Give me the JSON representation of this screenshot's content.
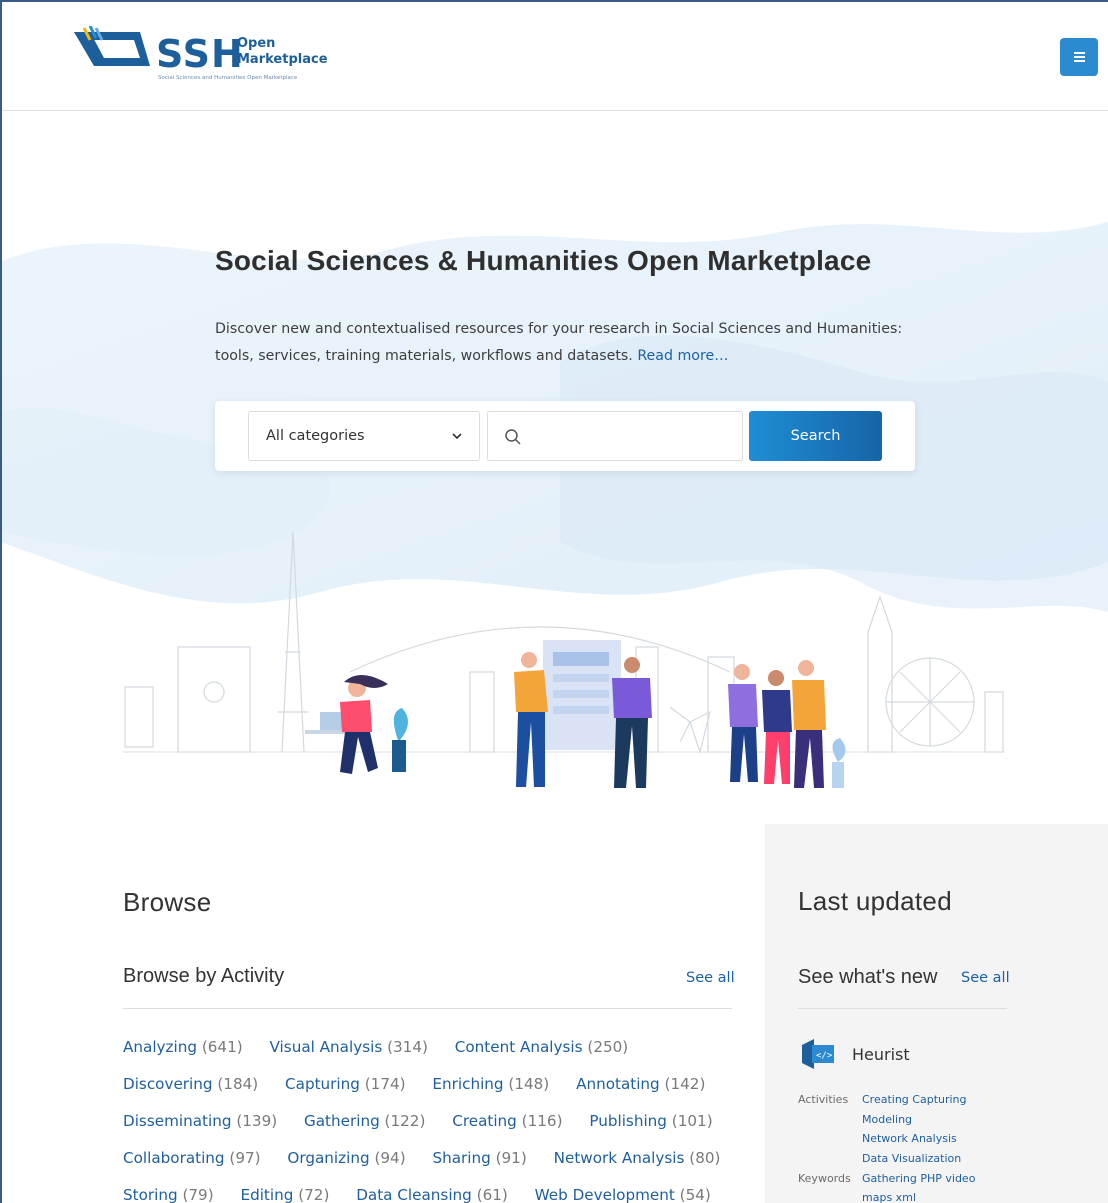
{
  "header": {
    "logo_ssh": "SSH",
    "logo_open": "Open",
    "logo_marketplace": "Marketplace",
    "logo_tagline": "Social Sciences and Humanities Open Marketplace",
    "menu_icon": "hamburger-menu-icon"
  },
  "hero": {
    "title": "Social Sciences & Humanities Open Marketplace",
    "description": "Discover new and contextualised resources for your research in Social Sciences and Humanities: tools, services, training materials, workflows and datasets.",
    "read_more": "Read more…"
  },
  "search": {
    "category_selected": "All categories",
    "input_value": "",
    "input_placeholder": "",
    "button_label": "Search"
  },
  "browse": {
    "title": "Browse",
    "subtitle": "Browse by Activity",
    "see_all": "See all",
    "rows": [
      [
        {
          "name": "Analyzing",
          "count": "(641)"
        },
        {
          "name": "Visual Analysis",
          "count": "(314)"
        },
        {
          "name": "Content Analysis",
          "count": "(250)"
        }
      ],
      [
        {
          "name": "Discovering",
          "count": "(184)"
        },
        {
          "name": "Capturing",
          "count": "(174)"
        },
        {
          "name": "Enriching",
          "count": "(148)"
        },
        {
          "name": "Annotating",
          "count": "(142)"
        }
      ],
      [
        {
          "name": "Disseminating",
          "count": "(139)"
        },
        {
          "name": "Gathering",
          "count": "(122)"
        },
        {
          "name": "Creating",
          "count": "(116)"
        },
        {
          "name": "Publishing",
          "count": "(101)"
        }
      ],
      [
        {
          "name": "Collaborating",
          "count": "(97)"
        },
        {
          "name": "Organizing",
          "count": "(94)"
        },
        {
          "name": "Sharing",
          "count": "(91)"
        },
        {
          "name": "Network Analysis",
          "count": "(80)"
        }
      ],
      [
        {
          "name": "Storing",
          "count": "(79)"
        },
        {
          "name": "Editing",
          "count": "(72)"
        },
        {
          "name": "Data Cleansing",
          "count": "(61)"
        },
        {
          "name": "Web Development",
          "count": "(54)"
        }
      ]
    ]
  },
  "last_updated": {
    "title": "Last updated",
    "subtitle": "See what's new",
    "see_all": "See all",
    "item": {
      "title": "Heurist",
      "activities_label": "Activities",
      "activities_line1": "Creating  Capturing",
      "activities_line2": "Modeling",
      "activities_line3": "Network Analysis",
      "activities_line4": "Data Visualization",
      "keywords_label": "Keywords",
      "keywords_line1": "Gathering  PHP  video",
      "keywords_line2": "maps  xml"
    }
  },
  "colors": {
    "brand_blue": "#1d5f9a",
    "link_blue": "#1f5fa0",
    "button_blue": "#1e8ed4",
    "accent_yellow": "#f5b800"
  }
}
